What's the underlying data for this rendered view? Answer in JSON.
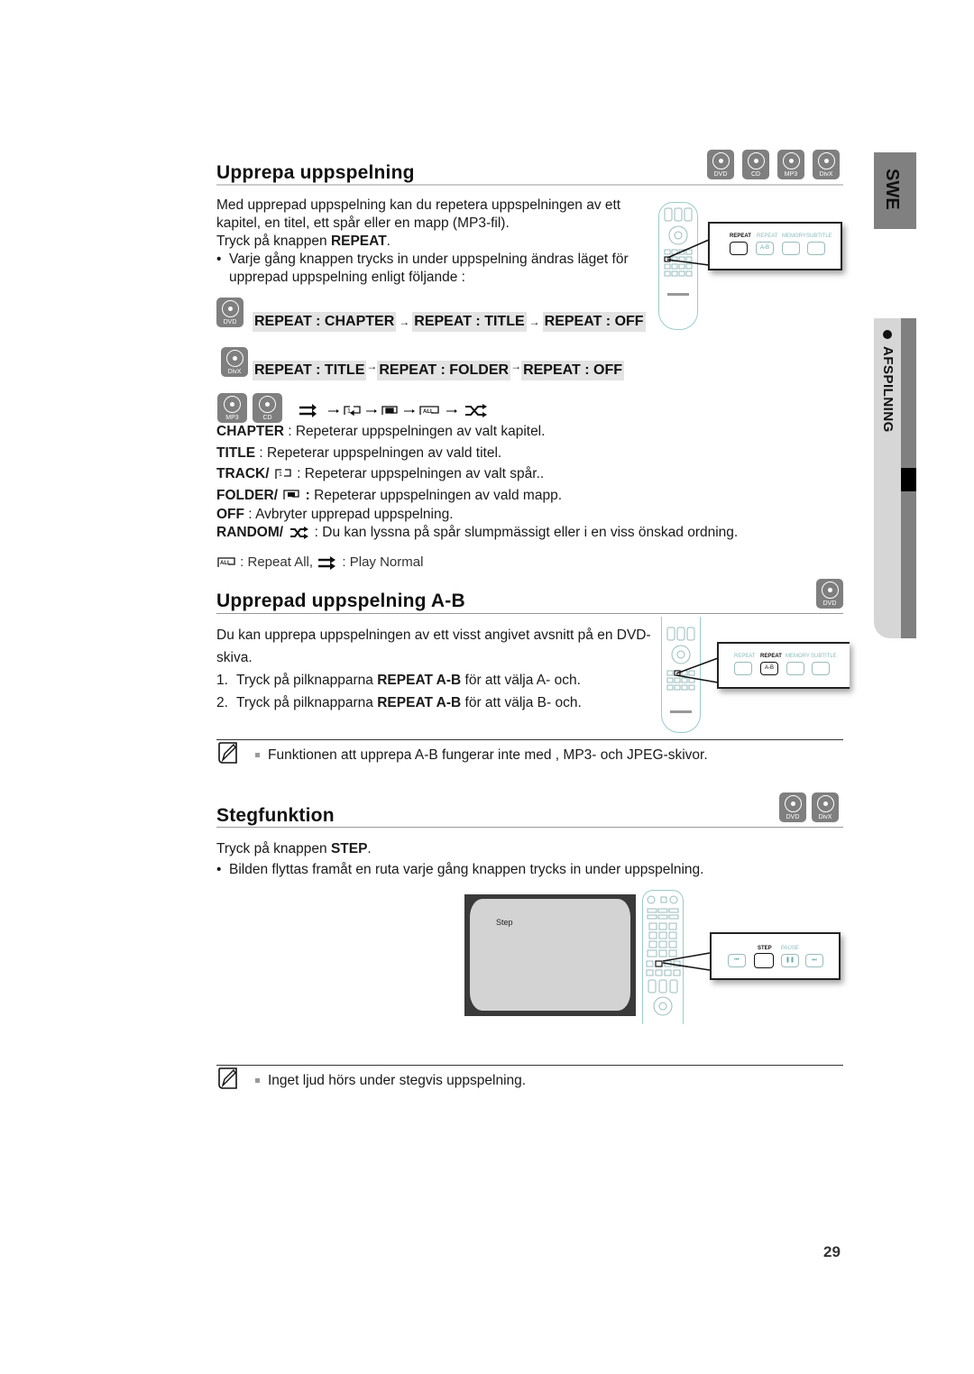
{
  "side_tabs": {
    "language": "SWE",
    "chapter": "AFSPILNING"
  },
  "section1": {
    "title": "Upprepa uppspelning",
    "discs": [
      "DVD",
      "CD",
      "MP3",
      "DivX"
    ],
    "intro_line1": "Med upprepad uppspelning kan du repetera uppspelningen av ett",
    "intro_line2": "kapitel, en titel, ett spår eller en mapp (MP3-fil).",
    "press_prefix": "Tryck på knappen ",
    "press_button": "REPEAT",
    "press_suffix": ".",
    "bullet_line1": "Varje gång knappen trycks in under uppspelning ändras läget för",
    "bullet_line2": "upprepad uppspelning enligt följande :",
    "remote_callout": {
      "buttons": [
        "REPEAT",
        "REPEAT",
        "MEMORY",
        "SUBTITLE"
      ],
      "sub_label": "A-B",
      "active": "REPEAT"
    },
    "dvd_chain": {
      "disc": "DVD",
      "steps": [
        "REPEAT : CHAPTER",
        "REPEAT : TITLE",
        "REPEAT : OFF"
      ]
    },
    "divx_chain": {
      "disc": "DivX",
      "steps": [
        "REPEAT : TITLE",
        "REPEAT : FOLDER",
        "REPEAT :  OFF"
      ]
    },
    "mp3cd_chain": {
      "discs": [
        "MP3",
        "CD"
      ],
      "icons": [
        "play-normal-icon",
        "repeat-track-icon",
        "repeat-folder-icon",
        "repeat-all-icon",
        "random-icon"
      ]
    },
    "definitions": [
      {
        "term": "CHAPTER",
        "sep": " : ",
        "text": "Repeterar uppspelningen av valt kapitel."
      },
      {
        "term": "TITLE",
        "sep": " : ",
        "text": "Repeterar uppspelningen av vald titel."
      },
      {
        "term": "TRACK/",
        "sep": " : ",
        "text": "Repeterar uppspelningen av valt spår.."
      },
      {
        "term": "FOLDER/",
        "sep": " : ",
        "text": "Repeterar uppspelningen av vald mapp."
      },
      {
        "term": "OFF",
        "sep": " : ",
        "text": "Avbryter upprepad uppspelning."
      },
      {
        "term": "RANDOM/",
        "sep": " : ",
        "text": "Du kan lyssna på spår slumpmässigt eller i en viss önskad ordning."
      }
    ],
    "legend_repeat_all": ": Repeat All,",
    "legend_play_normal": ": Play Normal"
  },
  "section2": {
    "title": "Upprepad uppspelning A-B",
    "disc": "DVD",
    "intro_line1": "Du kan upprepa uppspelningen av ett visst angivet avsnitt på en DVD-",
    "intro_line2": "skiva.",
    "steps": [
      {
        "num": "1.",
        "prefix": "Tryck på pilknapparna ",
        "bold": "REPEAT A-B",
        "suffix": " för att välja A- och."
      },
      {
        "num": "2.",
        "prefix": "Tryck på pilknapparna ",
        "bold": "REPEAT A-B",
        "suffix": " för att välja B- och."
      }
    ],
    "remote_callout": {
      "buttons": [
        "REPEAT",
        "REPEAT",
        "MEMORY",
        "SUBTITLE"
      ],
      "sub_label": "A-B",
      "active": "REPEAT A-B"
    },
    "note": "Funktionen att upprepa A-B fungerar inte med , MP3- och JPEG-skivor."
  },
  "section3": {
    "title": "Stegfunktion",
    "discs": [
      "DVD",
      "DivX"
    ],
    "press_prefix": "Tryck på knappen ",
    "press_button": "STEP",
    "press_suffix": ".",
    "bullet": "Bilden flyttas framåt en ruta varje gång knappen trycks in under uppspelning.",
    "screen_label": "Step",
    "remote_callout": {
      "labels": [
        "STEP",
        "PAUSE"
      ],
      "active": "STEP"
    },
    "note": "Inget ljud hörs under stegvis uppspelning."
  },
  "page_number": "29"
}
